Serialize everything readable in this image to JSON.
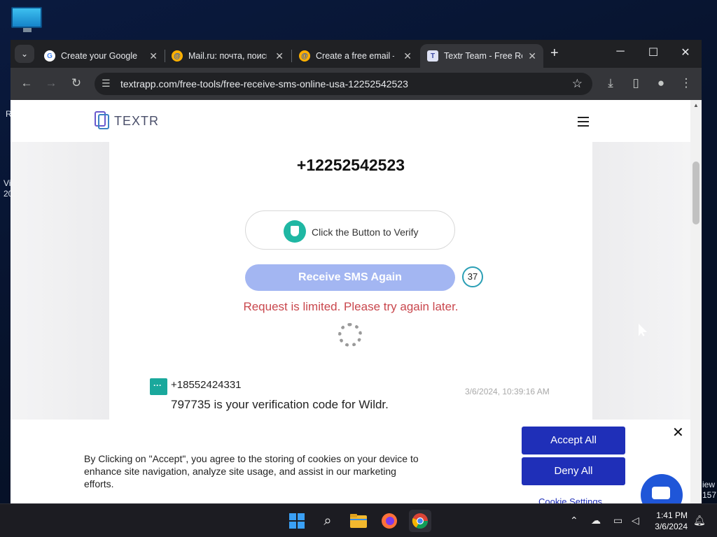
{
  "desktop": {
    "fragments": [
      "R",
      "Vi",
      "20",
      "iew",
      "157"
    ]
  },
  "browser": {
    "tabs": [
      {
        "title": "Create your Google A",
        "favicon": "google-g-icon",
        "active": false
      },
      {
        "title": "Mail.ru: почта, поиск",
        "favicon": "mailru-icon",
        "active": false
      },
      {
        "title": "Create a free email –",
        "favicon": "mailru-icon",
        "active": false
      },
      {
        "title": "Textr Team - Free Rec",
        "favicon": "textr-icon",
        "active": true
      }
    ],
    "url": "textrapp.com/free-tools/free-receive-sms-online-usa-12252542523",
    "window_controls": {
      "minimize": "─",
      "maximize": "☐",
      "close": "✕"
    }
  },
  "site": {
    "logo": "TEXTR",
    "phone_number": "+12252542523",
    "verify_label": "Click the Button to Verify",
    "receive_button": "Receive SMS Again",
    "counter": "37",
    "limit_message": "Request is limited. Please try again later.",
    "messages": [
      {
        "from": "+18552424331",
        "time": "3/6/2024, 10:39:16 AM",
        "text": "797735 is your verification code for Wildr."
      }
    ]
  },
  "cookie": {
    "text": "By Clicking on \"Accept\", you agree to the storing of cookies on your device to enhance site navigation, analyze site usage, and assist in our marketing efforts.",
    "accept": "Accept All",
    "deny": "Deny All",
    "settings": "Cookie Settings"
  },
  "taskbar": {
    "apps": [
      "start-icon",
      "search-icon",
      "file-explorer-icon",
      "firefox-icon",
      "chrome-icon"
    ],
    "time": "1:41 PM",
    "date": "3/6/2024"
  },
  "colors": {
    "accent": "#1f2fb8",
    "receive_button": "#a3b6f2",
    "limit_red": "#c9474d",
    "teal": "#1aa89c"
  }
}
